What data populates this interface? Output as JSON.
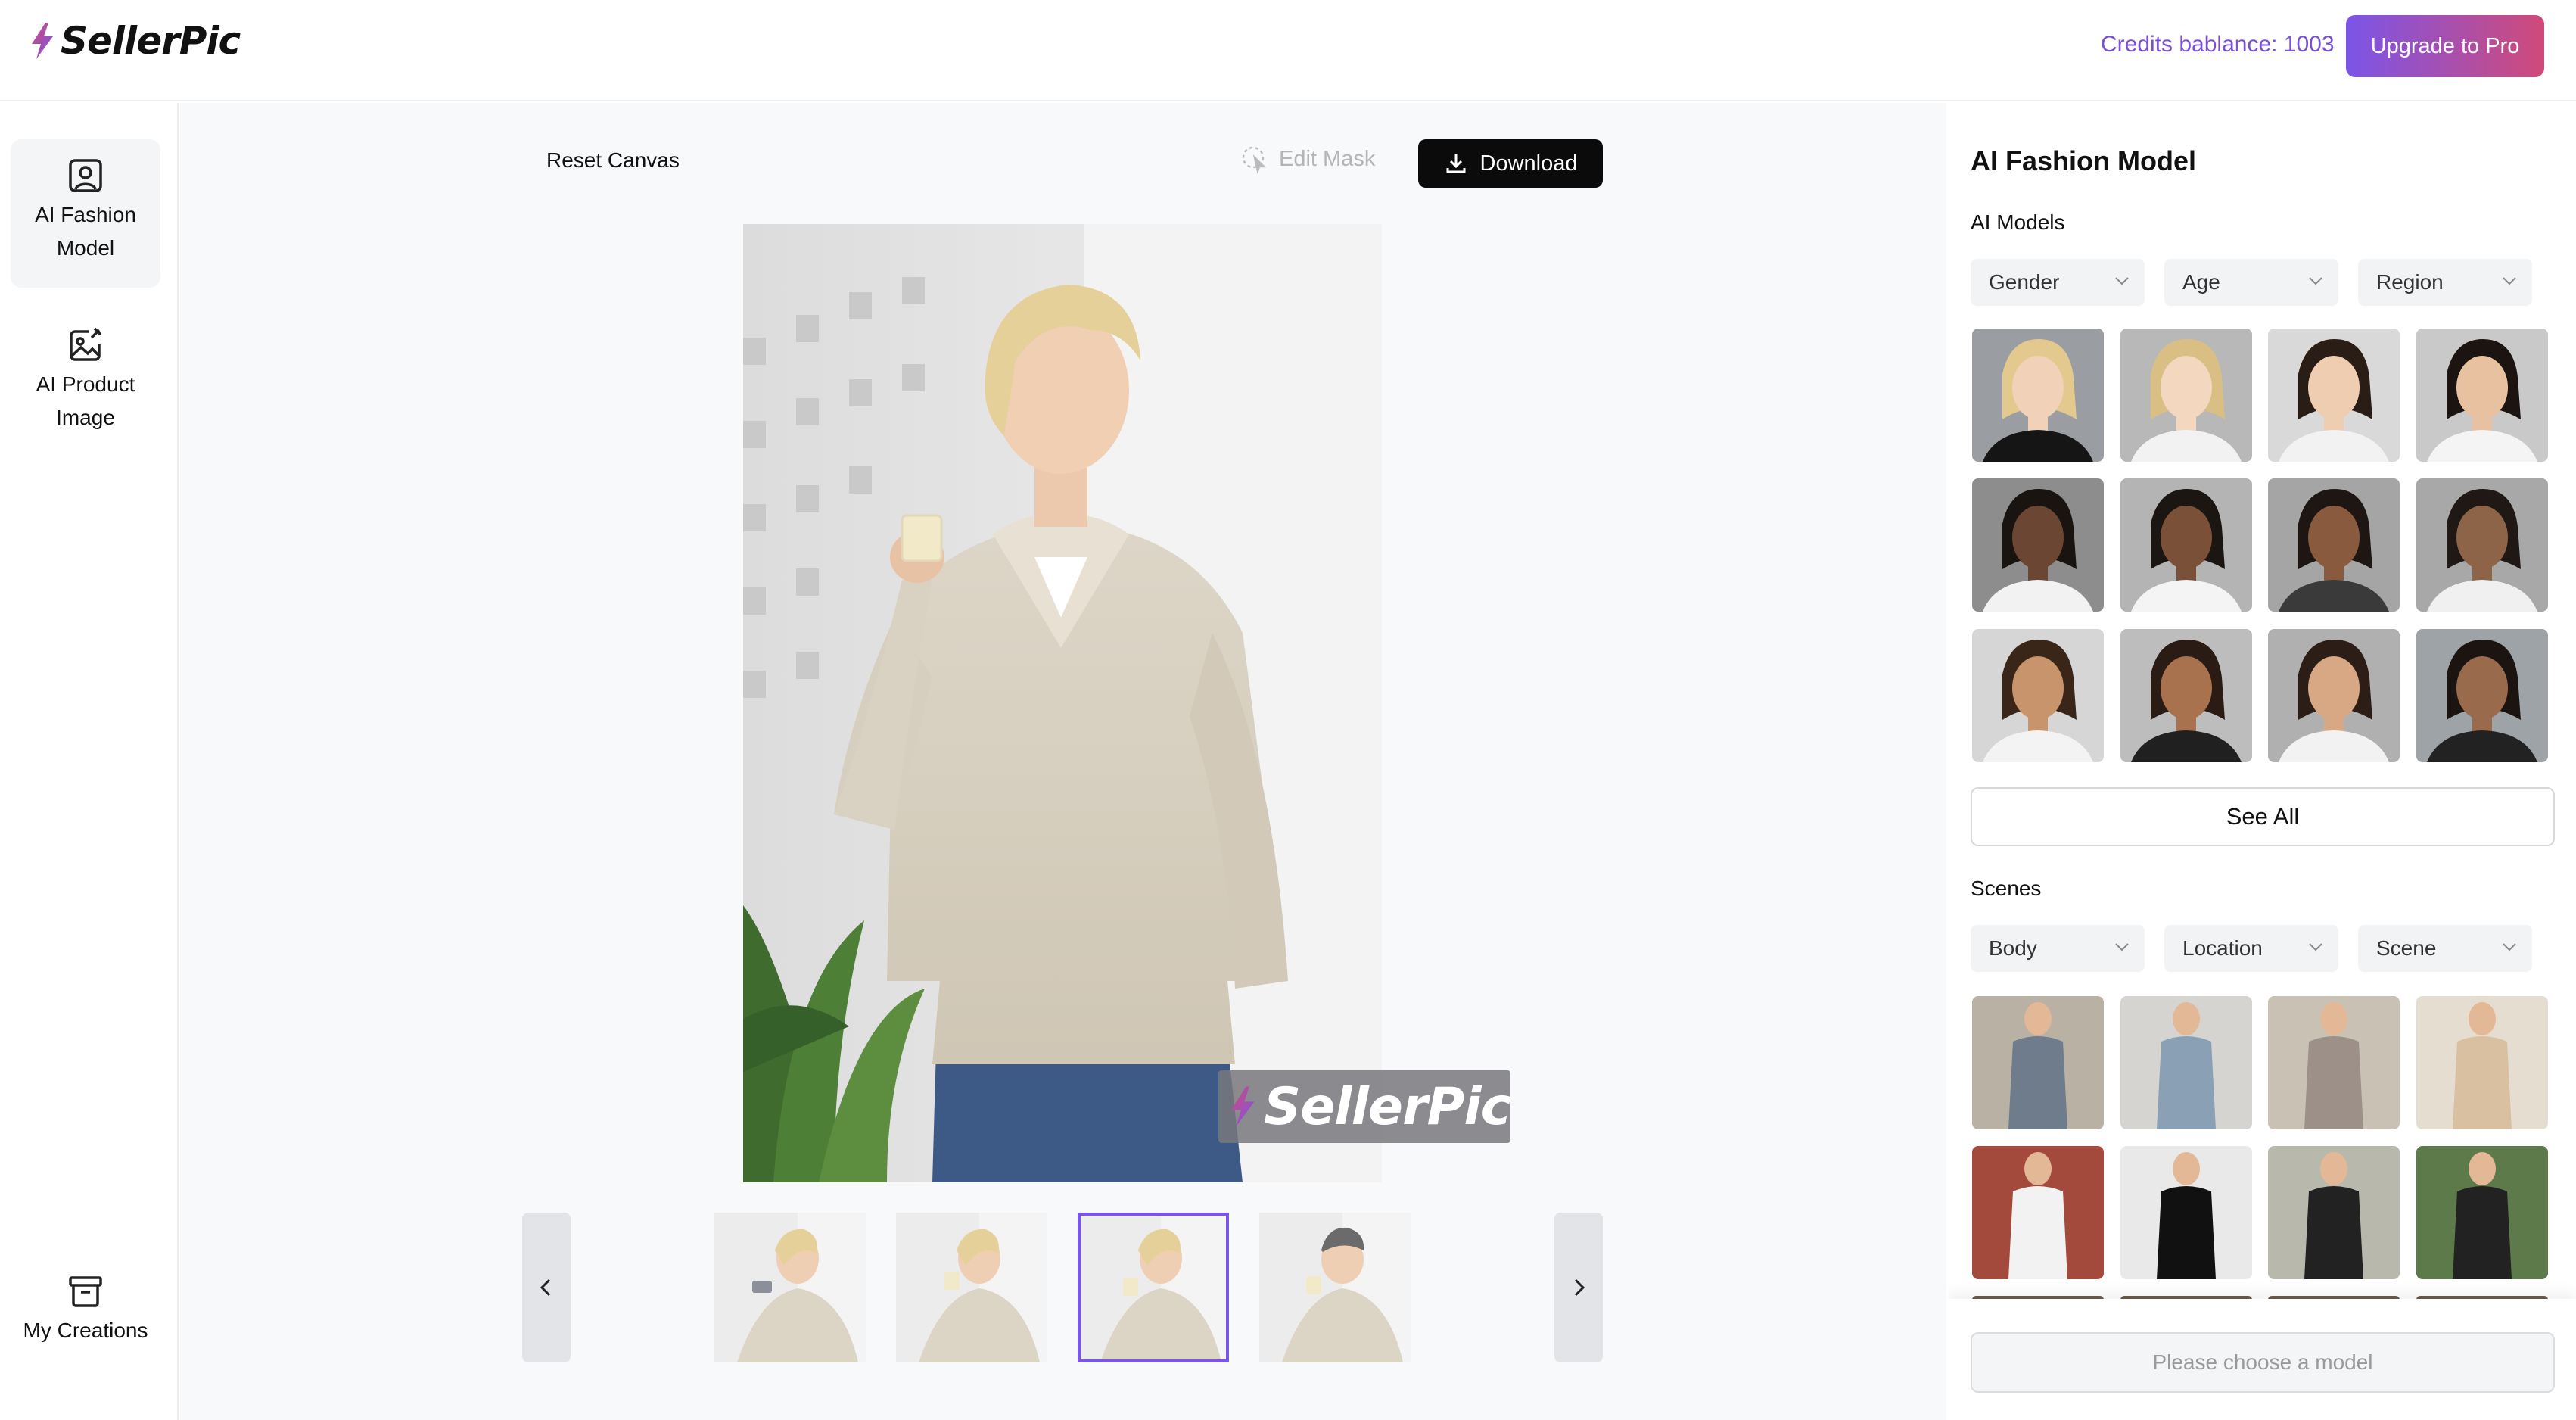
{
  "app": {
    "brand": "SellerPic",
    "credits_text": "Credits bablance: 1003",
    "upgrade_label": "Upgrade to Pro"
  },
  "sidebar": {
    "items": [
      {
        "label": "AI Fashion Model",
        "icon": "user-square-icon",
        "active": true
      },
      {
        "label": "AI Product Image",
        "icon": "image-edit-icon",
        "active": false
      },
      {
        "label": "My Creations",
        "icon": "archive-icon",
        "active": false
      }
    ]
  },
  "toolbar": {
    "reset_label": "Reset Canvas",
    "edit_mask_label": "Edit Mask",
    "download_label": "Download"
  },
  "canvas": {
    "watermark_text": "SellerPic",
    "thumbnails_count": 4,
    "selected_thumbnail": 3
  },
  "panel": {
    "title": "AI Fashion Model",
    "models_label": "AI Models",
    "model_filters": [
      "Gender",
      "Age",
      "Region"
    ],
    "see_all_label": "See All",
    "scenes_label": "Scenes",
    "scene_filters": [
      "Body",
      "Location",
      "Scene"
    ],
    "choose_placeholder": "Please choose a model"
  },
  "colors": {
    "accent": "#7b55e8",
    "upgrade_gradient_end": "#d04a79",
    "download_bg": "#0b0b0b"
  }
}
